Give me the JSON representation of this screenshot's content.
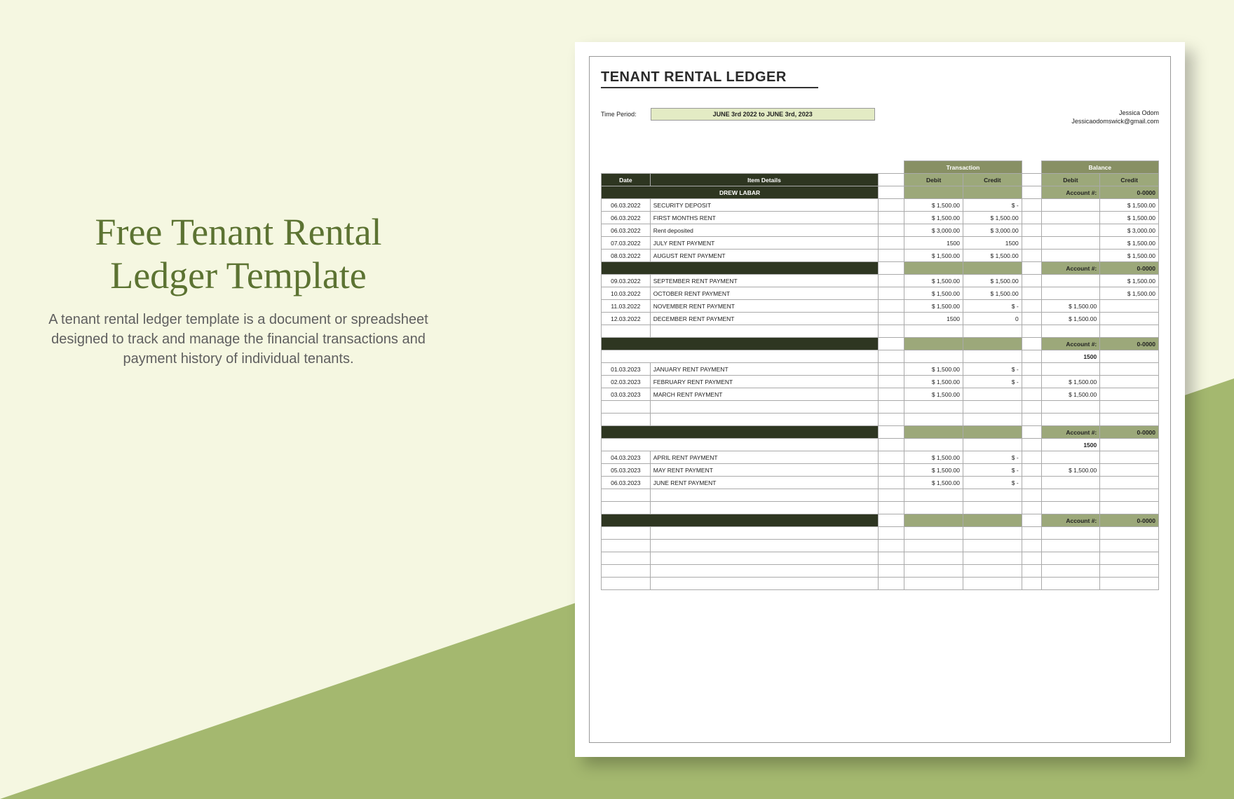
{
  "left": {
    "title": "Free Tenant Rental Ledger Template",
    "desc": "A tenant rental ledger template is a document or spreadsheet designed to track and manage the financial transactions and payment history of individual tenants."
  },
  "doc": {
    "title": "TENANT RENTAL LEDGER",
    "period_label": "Time Period:",
    "period_value": "JUNE 3rd 2022 to JUNE 3rd, 2023",
    "contact_name": "Jessica Odom",
    "contact_email": "Jessicaodomswick@gmail.com",
    "headers": {
      "date": "Date",
      "item": "Item Details",
      "transaction": "Transaction",
      "balance": "Balance",
      "debit": "Debit",
      "credit": "Credit",
      "account": "Account #:",
      "acct_val": "0-0000"
    },
    "tenant": "DREW LABAR",
    "sections": [
      {
        "rows": [
          {
            "date": "06.03.2022",
            "item": "SECURITY DEPOSIT",
            "td": "$    1,500.00",
            "tc": "$            -",
            "bd": "",
            "bc": "$    1,500.00"
          },
          {
            "date": "06.03.2022",
            "item": "FIRST MONTHS RENT",
            "td": "$    1,500.00",
            "tc": "$    1,500.00",
            "bd": "",
            "bc": "$    1,500.00"
          },
          {
            "date": "06.03.2022",
            "item": "Rent deposited",
            "td": "$    3,000.00",
            "tc": "$    3,000.00",
            "bd": "",
            "bc": "$    3,000.00"
          },
          {
            "date": "07.03.2022",
            "item": "JULY RENT PAYMENT",
            "td": "1500",
            "tc": "1500",
            "bd": "",
            "bc": "$    1,500.00",
            "plain": true
          },
          {
            "date": "08.03.2022",
            "item": "AUGUST RENT PAYMENT",
            "td": "$    1,500.00",
            "tc": "$    1,500.00",
            "bd": "",
            "bc": "$    1,500.00"
          }
        ]
      },
      {
        "rows": [
          {
            "date": "09.03.2022",
            "item": "SEPTEMBER RENT PAYMENT",
            "td": "$    1,500.00",
            "tc": "$    1,500.00",
            "bd": "",
            "bc": "$    1,500.00"
          },
          {
            "date": "10.03.2022",
            "item": "OCTOBER RENT PAYMENT",
            "td": "$    1,500.00",
            "tc": "$    1,500.00",
            "bd": "",
            "bc": "$    1,500.00"
          },
          {
            "date": "11.03.2022",
            "item": "NOVEMBER RENT PAYMENT",
            "td": "$    1,500.00",
            "tc": "$            -",
            "bd": "$    1,500.00",
            "bc": ""
          },
          {
            "date": "12.03.2022",
            "item": "DECEMBER RENT PAYMENT",
            "td": "1500",
            "tc": "0",
            "bd": "$    1,500.00",
            "bc": "",
            "plain": true
          },
          {
            "date": "",
            "item": "",
            "td": "",
            "tc": "",
            "bd": "",
            "bc": ""
          }
        ]
      },
      {
        "top_bd": "1500",
        "rows": [
          {
            "date": "01.03.2023",
            "item": "JANUARY RENT PAYMENT",
            "td": "$    1,500.00",
            "tc": "$            -",
            "bd": "",
            "bc": ""
          },
          {
            "date": "02.03.2023",
            "item": "FEBRUARY RENT PAYMENT",
            "td": "$    1,500.00",
            "tc": "$            -",
            "bd": "$    1,500.00",
            "bc": ""
          },
          {
            "date": "03.03.2023",
            "item": "MARCH RENT PAYMENT",
            "td": "$    1,500.00",
            "tc": "",
            "bd": "$    1,500.00",
            "bc": ""
          },
          {
            "date": "",
            "item": "",
            "td": "",
            "tc": "",
            "bd": "",
            "bc": ""
          },
          {
            "date": "",
            "item": "",
            "td": "",
            "tc": "",
            "bd": "",
            "bc": ""
          }
        ]
      },
      {
        "top_bd": "1500",
        "rows": [
          {
            "date": "04.03.2023",
            "item": "APRIL RENT PAYMENT",
            "td": "$    1,500.00",
            "tc": "$            -",
            "bd": "",
            "bc": ""
          },
          {
            "date": "05.03.2023",
            "item": "MAY RENT PAYMENT",
            "td": "$    1,500.00",
            "tc": "$            -",
            "bd": "$    1,500.00",
            "bc": ""
          },
          {
            "date": "06.03.2023",
            "item": "JUNE RENT PAYMENT",
            "td": "$    1,500.00",
            "tc": "$            -",
            "bd": "",
            "bc": ""
          },
          {
            "date": "",
            "item": "",
            "td": "",
            "tc": "",
            "bd": "",
            "bc": ""
          },
          {
            "date": "",
            "item": "",
            "td": "",
            "tc": "",
            "bd": "",
            "bc": ""
          }
        ]
      },
      {
        "rows": [
          {
            "date": "",
            "item": "",
            "td": "",
            "tc": "",
            "bd": "",
            "bc": ""
          },
          {
            "date": "",
            "item": "",
            "td": "",
            "tc": "",
            "bd": "",
            "bc": ""
          },
          {
            "date": "",
            "item": "",
            "td": "",
            "tc": "",
            "bd": "",
            "bc": ""
          },
          {
            "date": "",
            "item": "",
            "td": "",
            "tc": "",
            "bd": "",
            "bc": ""
          },
          {
            "date": "",
            "item": "",
            "td": "",
            "tc": "",
            "bd": "",
            "bc": ""
          }
        ]
      }
    ]
  }
}
